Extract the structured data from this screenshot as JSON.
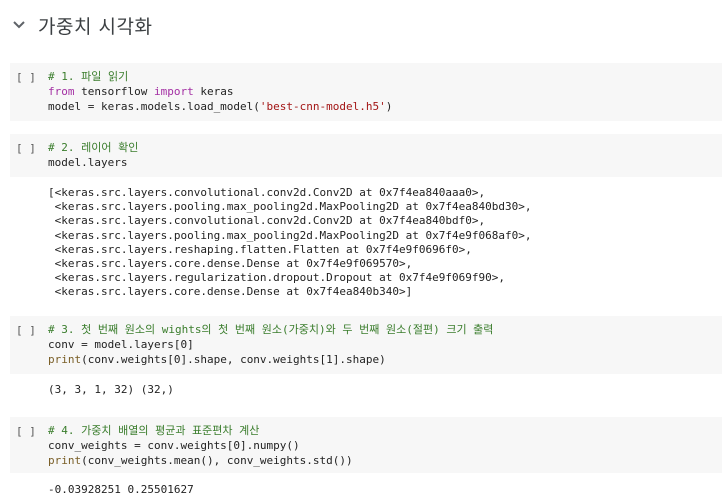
{
  "section": {
    "title": "가중치 시각화"
  },
  "run_label": "[ ]",
  "cells": [
    {
      "code": [
        "# 1. 파일 읽기",
        "from tensorflow import keras",
        "model = keras.models.load_model('best-cnn-model.h5')"
      ],
      "output": []
    },
    {
      "code": [
        "# 2. 레이어 확인",
        "model.layers"
      ],
      "output": [
        "[<keras.src.layers.convolutional.conv2d.Conv2D at 0x7f4ea840aaa0>,",
        " <keras.src.layers.pooling.max_pooling2d.MaxPooling2D at 0x7f4ea840bd30>,",
        " <keras.src.layers.convolutional.conv2d.Conv2D at 0x7f4ea840bdf0>,",
        " <keras.src.layers.pooling.max_pooling2d.MaxPooling2D at 0x7f4e9f068af0>,",
        " <keras.src.layers.reshaping.flatten.Flatten at 0x7f4e9f0696f0>,",
        " <keras.src.layers.core.dense.Dense at 0x7f4e9f069570>,",
        " <keras.src.layers.regularization.dropout.Dropout at 0x7f4e9f069f90>,",
        " <keras.src.layers.core.dense.Dense at 0x7f4ea840b340>]"
      ]
    },
    {
      "code": [
        "# 3. 첫 번째 원소의 wights의 첫 번째 원소(가중치)와 두 번째 원소(절편) 크기 출력",
        "conv = model.layers[0]",
        "print(conv.weights[0].shape, conv.weights[1].shape)"
      ],
      "output": [
        "(3, 3, 1, 32) (32,)"
      ]
    },
    {
      "code": [
        "# 4. 가중치 배열의 평균과 표준편차 계산",
        "conv_weights = conv.weights[0].numpy()",
        "print(conv_weights.mean(), conv_weights.std())"
      ],
      "output": [
        "-0.03928251 0.25501627"
      ]
    }
  ]
}
